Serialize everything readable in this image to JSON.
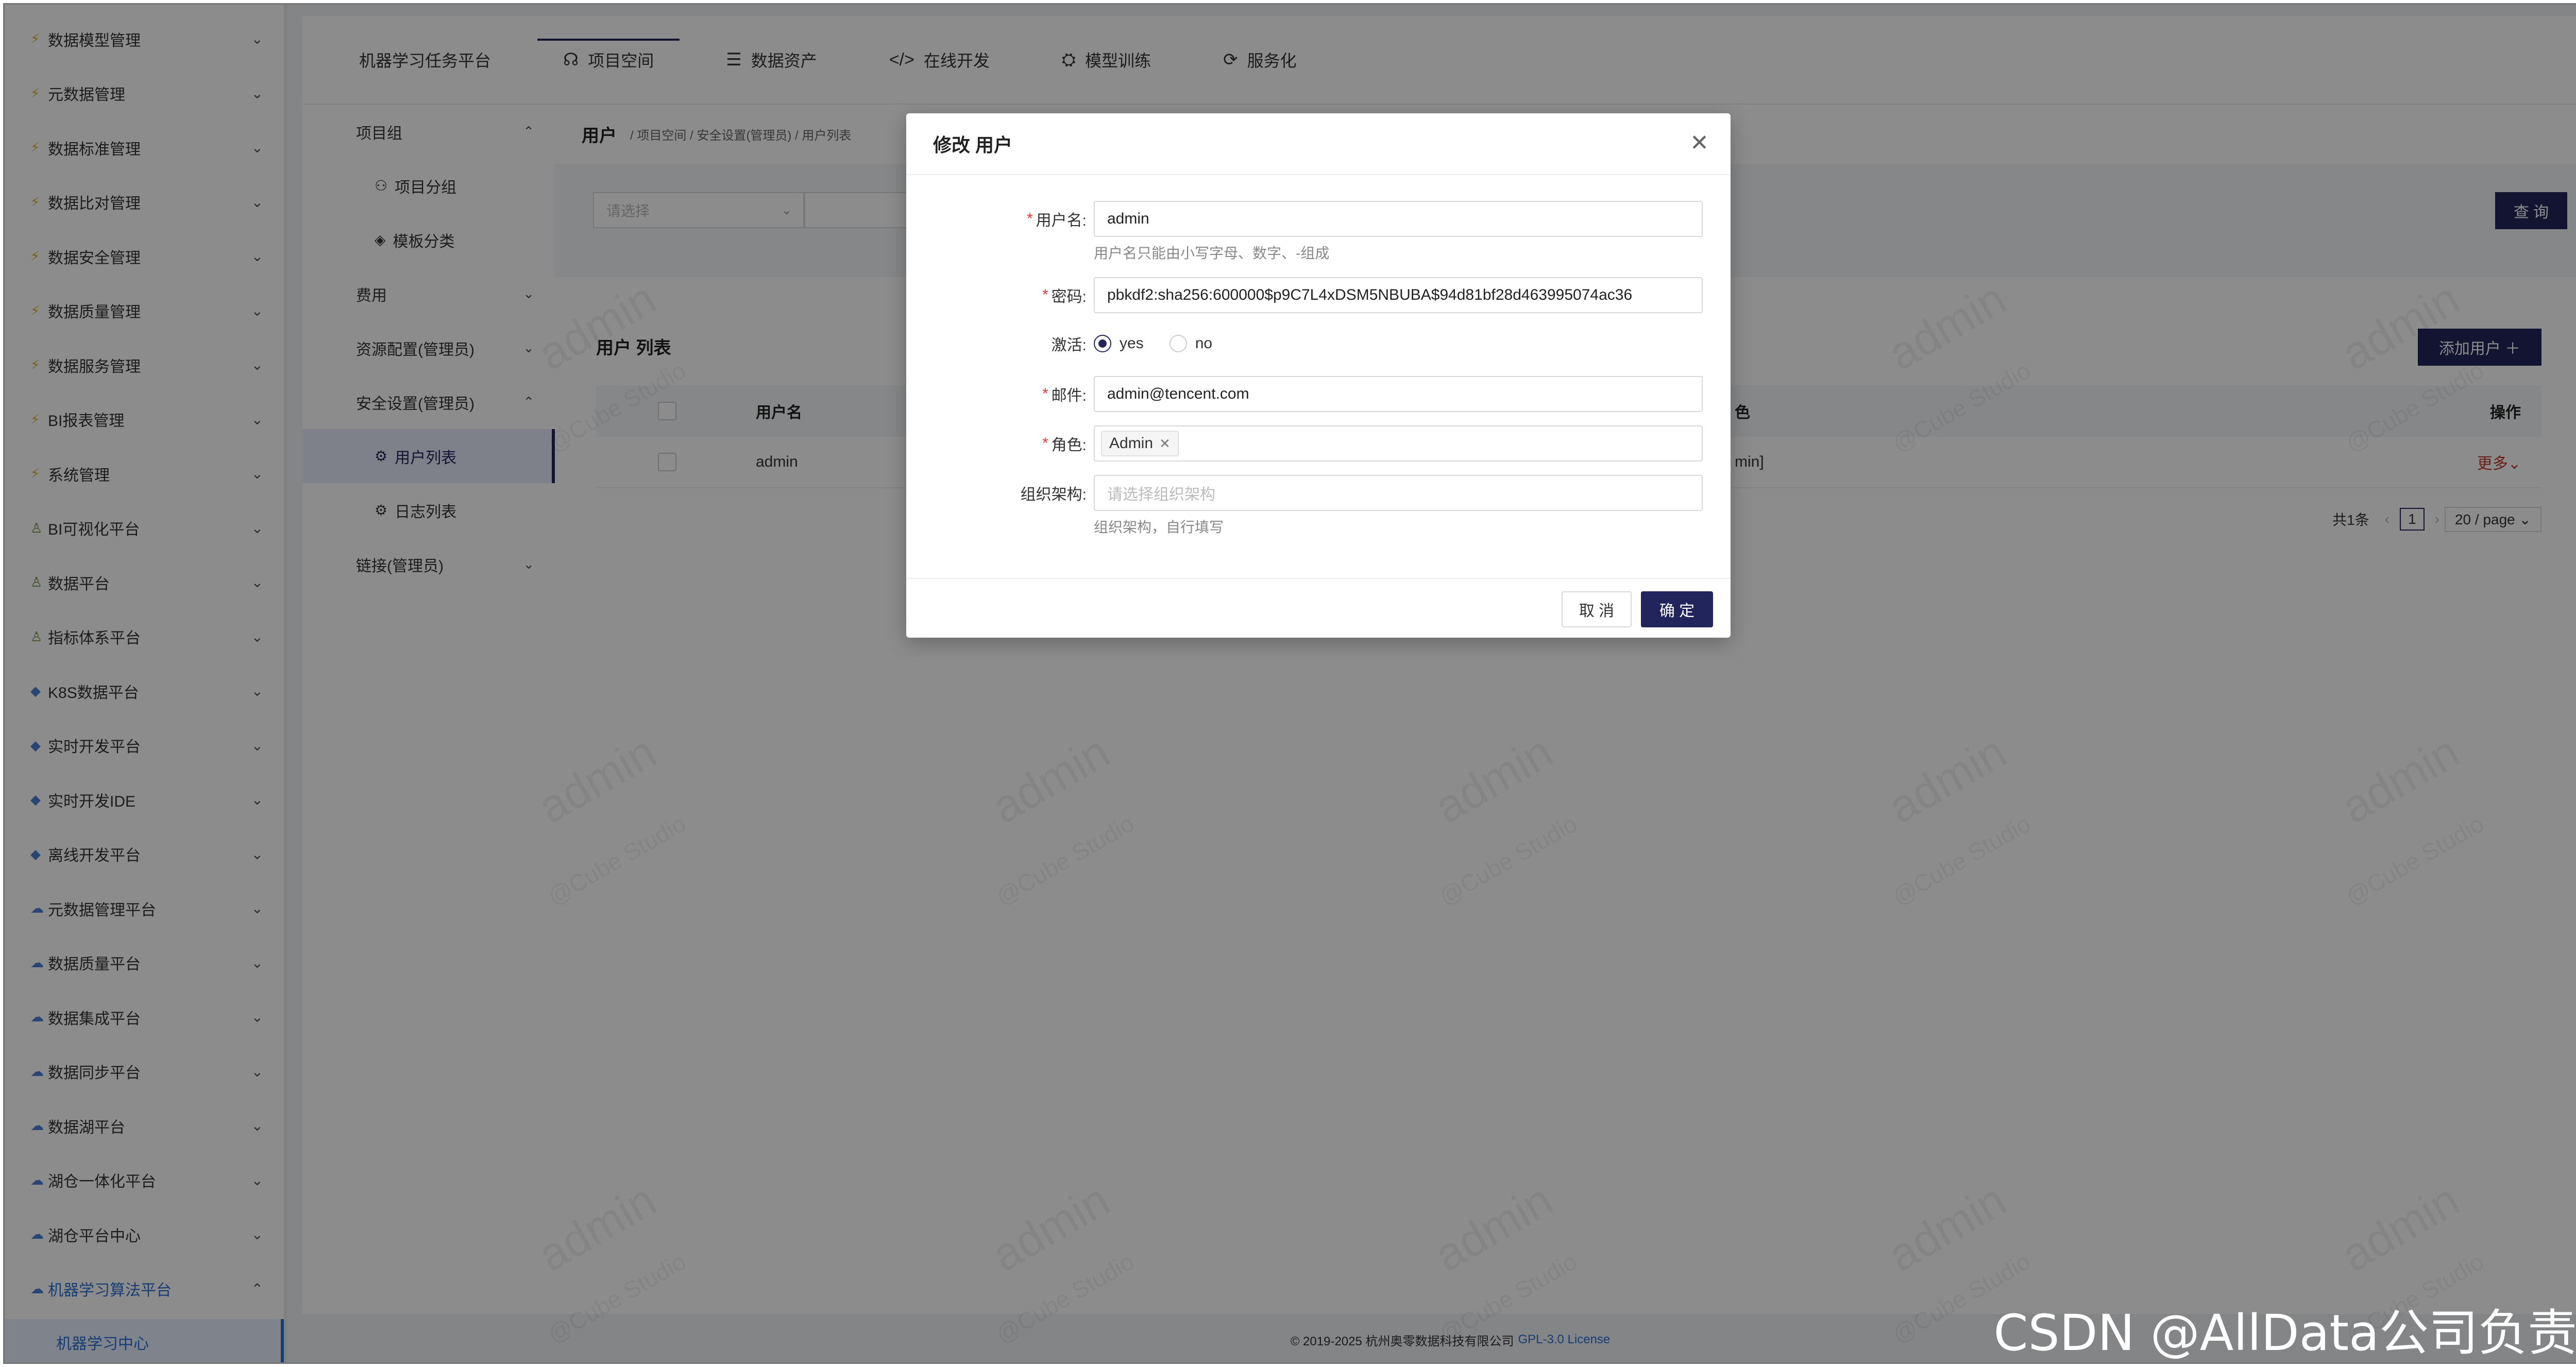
{
  "sidebar": {
    "items": [
      {
        "label": "数据模型管理",
        "icon": "lightning-icon"
      },
      {
        "label": "元数据管理",
        "icon": "lightning-icon"
      },
      {
        "label": "数据标准管理",
        "icon": "lightning-icon"
      },
      {
        "label": "数据比对管理",
        "icon": "lightning-icon"
      },
      {
        "label": "数据安全管理",
        "icon": "lightning-icon"
      },
      {
        "label": "数据质量管理",
        "icon": "lightning-icon"
      },
      {
        "label": "数据服务管理",
        "icon": "lightning-icon"
      },
      {
        "label": "BI报表管理",
        "icon": "lightning-icon"
      },
      {
        "label": "系统管理",
        "icon": "lightning-icon"
      },
      {
        "label": "BI可视化平台",
        "icon": "person-icon"
      },
      {
        "label": "数据平台",
        "icon": "person-icon"
      },
      {
        "label": "指标体系平台",
        "icon": "person-icon"
      },
      {
        "label": "K8S数据平台",
        "icon": "diamond-icon"
      },
      {
        "label": "实时开发平台",
        "icon": "diamond-icon"
      },
      {
        "label": "实时开发IDE",
        "icon": "diamond-icon"
      },
      {
        "label": "离线开发平台",
        "icon": "diamond-icon"
      },
      {
        "label": "元数据管理平台",
        "icon": "cloud-icon"
      },
      {
        "label": "数据质量平台",
        "icon": "cloud-icon"
      },
      {
        "label": "数据集成平台",
        "icon": "cloud-icon"
      },
      {
        "label": "数据同步平台",
        "icon": "cloud-icon"
      },
      {
        "label": "数据湖平台",
        "icon": "cloud-icon"
      },
      {
        "label": "湖仓一体化平台",
        "icon": "cloud-icon"
      },
      {
        "label": "湖仓平台中心",
        "icon": "cloud-icon"
      },
      {
        "label": "机器学习算法平台",
        "icon": "cloud-icon"
      }
    ],
    "active_sub": "机器学习中心"
  },
  "topnav": {
    "tabs": [
      {
        "label": "机器学习任务平台",
        "icon": ""
      },
      {
        "label": "项目空间",
        "icon": "team-icon"
      },
      {
        "label": "数据资产",
        "icon": "database-icon"
      },
      {
        "label": "在线开发",
        "icon": "code-icon"
      },
      {
        "label": "模型训练",
        "icon": "training-icon"
      },
      {
        "label": "服务化",
        "icon": "service-icon"
      }
    ]
  },
  "subnav": {
    "items": [
      {
        "label": "项目组",
        "chev": "⌃"
      },
      {
        "label": "项目分组",
        "sub": true,
        "icon": "group-icon"
      },
      {
        "label": "模板分类",
        "sub": true,
        "icon": "layers-icon"
      },
      {
        "label": "费用",
        "chev": "⌄"
      },
      {
        "label": "资源配置(管理员)",
        "chev": "⌄"
      },
      {
        "label": "安全设置(管理员)",
        "chev": "⌃"
      },
      {
        "label": "用户列表",
        "sub": true,
        "icon": "gear-icon"
      },
      {
        "label": "日志列表",
        "sub": true,
        "icon": "gear-icon"
      },
      {
        "label": "链接(管理员)",
        "chev": "⌄"
      }
    ]
  },
  "page": {
    "title": "用户",
    "breadcrumb": "/ 项目空间 / 安全设置(管理员) / 用户列表",
    "filter_placeholder": "请选择",
    "query_button": "查 询",
    "list_title": "用户 列表",
    "add_button": "添加用户 ＋",
    "columns": {
      "user": "用户名",
      "role": "色",
      "op": "操作"
    },
    "row": {
      "user": "admin",
      "role": "min]",
      "op": "更多⌄"
    },
    "pager": {
      "total": "共1条",
      "page": "1",
      "size": "20 / page ⌄"
    }
  },
  "footer": {
    "text": "© 2019-2025 杭州奥零数据科技有限公司",
    "license": "GPL-3.0 License"
  },
  "watermark": {
    "main": "admin",
    "sub": "@Cube Studio"
  },
  "modal": {
    "title": "修改 用户",
    "fields": {
      "username_label": "用户名:",
      "username_value": "admin",
      "username_help": "用户名只能由小写字母、数字、-组成",
      "password_label": "密码:",
      "password_value": "pbkdf2:sha256:600000$p9C7L4xDSM5NBUBA$94d81bf28d463995074ac36",
      "active_label": "激活:",
      "active_yes": "yes",
      "active_no": "no",
      "email_label": "邮件:",
      "email_value": "admin@tencent.com",
      "role_label": "角色:",
      "role_tag": "Admin",
      "org_label": "组织架构:",
      "org_placeholder": "请选择组织架构",
      "org_help": "组织架构，自行填写"
    },
    "cancel": "取 消",
    "ok": "确 定"
  },
  "csdn_watermark": "CSDN @AllData公司负责人",
  "colors": {
    "primary": "#22255c",
    "link": "#2b6fd4",
    "required": "#e53935"
  }
}
